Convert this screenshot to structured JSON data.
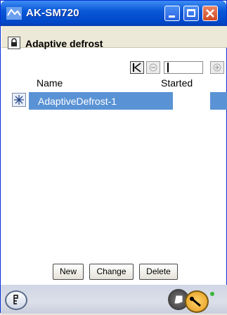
{
  "window": {
    "title": "AK-SM720"
  },
  "header": {
    "title": "Adaptive defrost"
  },
  "table": {
    "columns": [
      "Name",
      "Started"
    ],
    "rows": [
      {
        "name": "AdaptiveDefrost-1",
        "started": ""
      }
    ]
  },
  "actions": {
    "new": "New",
    "change": "Change",
    "delete": "Delete"
  },
  "colors": {
    "titlebar": "#0a58d8",
    "selection": "#5a93d5",
    "close": "#d34a22",
    "accent_orange": "#f0a830"
  }
}
